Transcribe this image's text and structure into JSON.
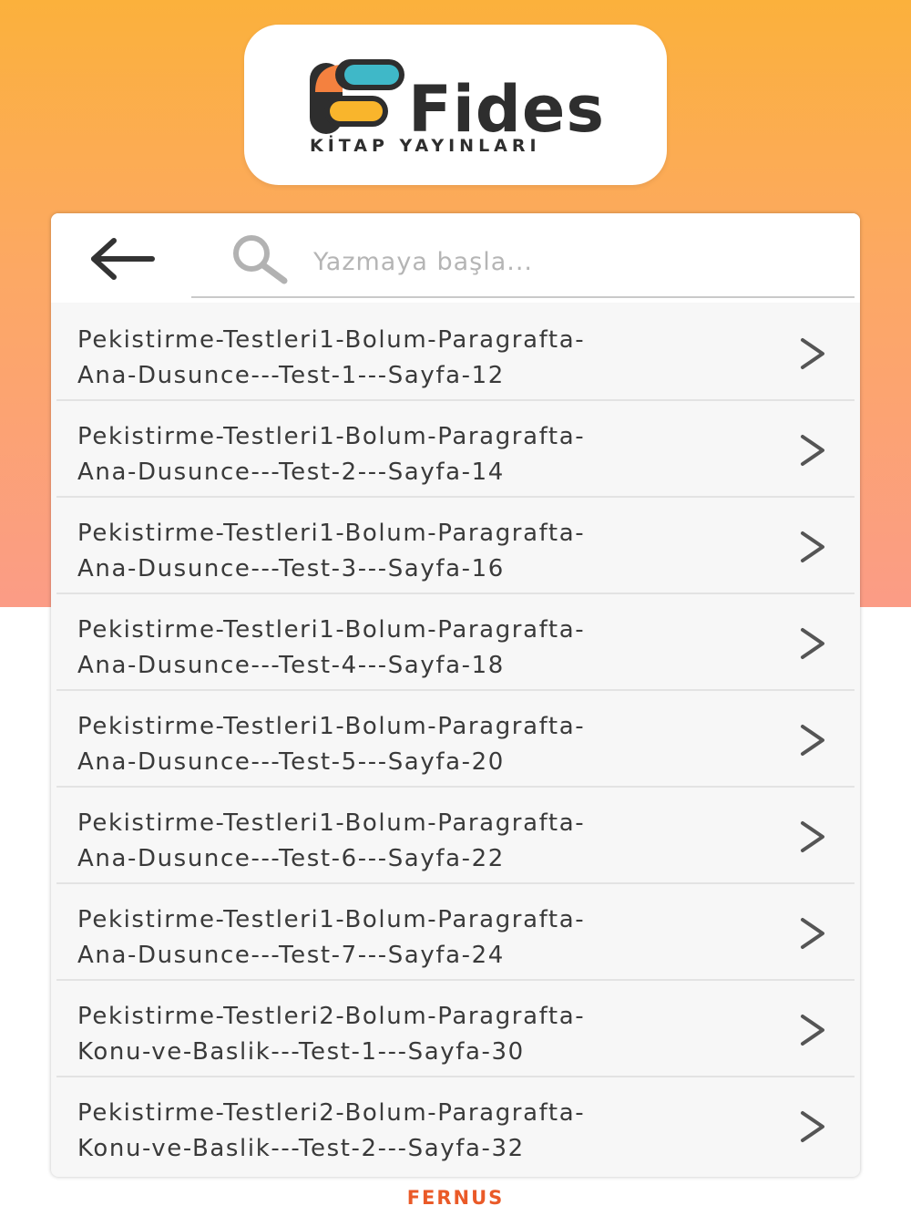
{
  "brand": {
    "logo_text": "Fides",
    "logo_subtitle": "KİTAP YAYINLARI",
    "colors": {
      "orange": "#f4813f",
      "teal": "#3fb8c8",
      "yellow": "#f9b52c",
      "dark": "#2e2e2e"
    }
  },
  "header": {
    "back_icon": "arrow-left-icon",
    "search_icon": "search-icon",
    "search_placeholder": "Yazmaya başla..."
  },
  "items": [
    {
      "line1": "Pekistirme-Testleri1-Bolum-Paragrafta-",
      "line2": "Ana-Dusunce---Test-1---Sayfa-12"
    },
    {
      "line1": "Pekistirme-Testleri1-Bolum-Paragrafta-",
      "line2": "Ana-Dusunce---Test-2---Sayfa-14"
    },
    {
      "line1": "Pekistirme-Testleri1-Bolum-Paragrafta-",
      "line2": "Ana-Dusunce---Test-3---Sayfa-16"
    },
    {
      "line1": "Pekistirme-Testleri1-Bolum-Paragrafta-",
      "line2": "Ana-Dusunce---Test-4---Sayfa-18"
    },
    {
      "line1": "Pekistirme-Testleri1-Bolum-Paragrafta-",
      "line2": "Ana-Dusunce---Test-5---Sayfa-20"
    },
    {
      "line1": "Pekistirme-Testleri1-Bolum-Paragrafta-",
      "line2": "Ana-Dusunce---Test-6---Sayfa-22"
    },
    {
      "line1": "Pekistirme-Testleri1-Bolum-Paragrafta-",
      "line2": "Ana-Dusunce---Test-7---Sayfa-24"
    },
    {
      "line1": "Pekistirme-Testleri2-Bolum-Paragrafta-",
      "line2": "Konu-ve-Baslik---Test-1---Sayfa-30"
    },
    {
      "line1": "Pekistirme-Testleri2-Bolum-Paragrafta-",
      "line2": "Konu-ve-Baslik---Test-2---Sayfa-32"
    }
  ],
  "item_icon": "chevron-right-icon",
  "footer": {
    "brand": "FERNUS"
  }
}
